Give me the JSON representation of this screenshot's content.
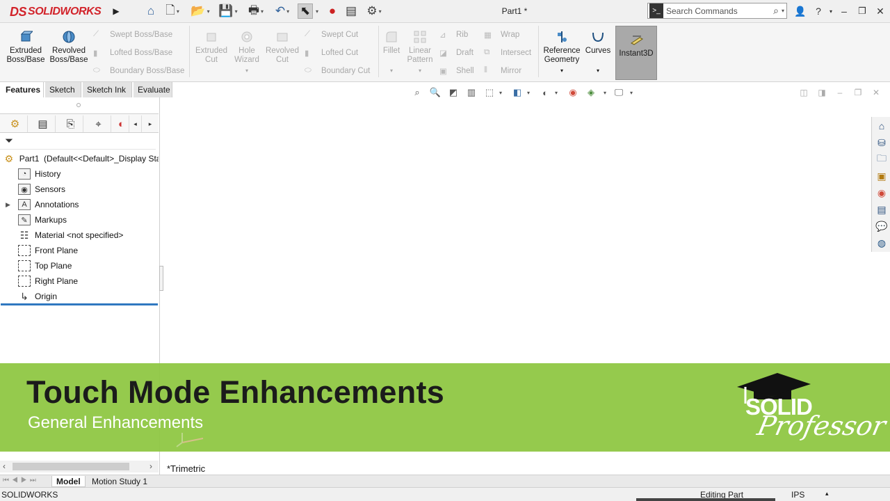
{
  "app": {
    "brand": "SOLIDWORKS",
    "document_title": "Part1 *",
    "search_placeholder": "Search Commands"
  },
  "quick_access": {
    "icons": [
      "home-icon",
      "new-document-icon",
      "open-icon",
      "save-icon",
      "print-icon",
      "undo-icon",
      "select-icon",
      "traffic-light-icon",
      "file-properties-icon",
      "options-icon"
    ]
  },
  "ribbon": {
    "extruded_boss": "Extruded\nBoss/Base",
    "revolved_boss": "Revolved\nBoss/Base",
    "swept_boss": "Swept Boss/Base",
    "lofted_boss": "Lofted Boss/Base",
    "boundary_boss": "Boundary Boss/Base",
    "extruded_cut": "Extruded\nCut",
    "hole_wizard": "Hole\nWizard",
    "revolved_cut": "Revolved\nCut",
    "swept_cut": "Swept Cut",
    "lofted_cut": "Lofted Cut",
    "boundary_cut": "Boundary Cut",
    "fillet": "Fillet",
    "linear_pattern": "Linear\nPattern",
    "rib": "Rib",
    "draft": "Draft",
    "shell": "Shell",
    "wrap": "Wrap",
    "intersect": "Intersect",
    "mirror": "Mirror",
    "reference_geometry": "Reference\nGeometry",
    "curves": "Curves",
    "instant3d": "Instant3D"
  },
  "command_tabs": [
    "Features",
    "Sketch",
    "Sketch Ink",
    "Evaluate"
  ],
  "feature_tree": {
    "root": "Part1  (Default<<Default>_Display Sta",
    "items": [
      {
        "label": "History",
        "icon": "history-icon"
      },
      {
        "label": "Sensors",
        "icon": "sensors-icon"
      },
      {
        "label": "Annotations",
        "icon": "annotations-icon"
      },
      {
        "label": "Markups",
        "icon": "markups-icon"
      },
      {
        "label": "Material <not specified>",
        "icon": "material-icon"
      },
      {
        "label": "Front Plane",
        "icon": "plane-icon"
      },
      {
        "label": "Top Plane",
        "icon": "plane-icon"
      },
      {
        "label": "Right Plane",
        "icon": "plane-icon"
      },
      {
        "label": "Origin",
        "icon": "origin-icon"
      }
    ]
  },
  "viewport": {
    "view_label": "*Trimetric"
  },
  "banner": {
    "title": "Touch Mode Enhancements",
    "subtitle": "General Enhancements",
    "logo_solid": "SOLID",
    "logo_professor": "Professor"
  },
  "bottom_tabs": [
    "Model",
    "Motion Study 1"
  ],
  "status": {
    "left": "SOLIDWORKS",
    "editing": "Editing Part",
    "units": "IPS"
  },
  "colors": {
    "banner_green": "#8dc63f",
    "brand_red": "#d2232a",
    "tree_highlight": "#2f78c0"
  }
}
